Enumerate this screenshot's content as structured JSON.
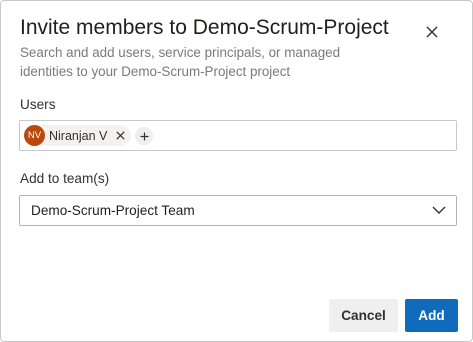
{
  "dialog": {
    "title": "Invite members to Demo-Scrum-Project",
    "subtitle": "Search and add users, service principals, or managed identities to your Demo-Scrum-Project project",
    "close_icon": "close-icon"
  },
  "users": {
    "label": "Users",
    "selected": [
      {
        "initials": "NV",
        "name": "Niranjan V",
        "avatar_color": "#b8490b"
      }
    ],
    "remove_icon": "close-icon",
    "add_icon": "plus-icon"
  },
  "team": {
    "label": "Add to team(s)",
    "value": "Demo-Scrum-Project Team",
    "chevron_icon": "chevron-down-icon"
  },
  "footer": {
    "cancel_label": "Cancel",
    "add_label": "Add"
  },
  "colors": {
    "primary": "#0f6cbd",
    "avatar": "#b8490b",
    "secondary_button": "#efefef",
    "border": "#c8c8c8"
  }
}
